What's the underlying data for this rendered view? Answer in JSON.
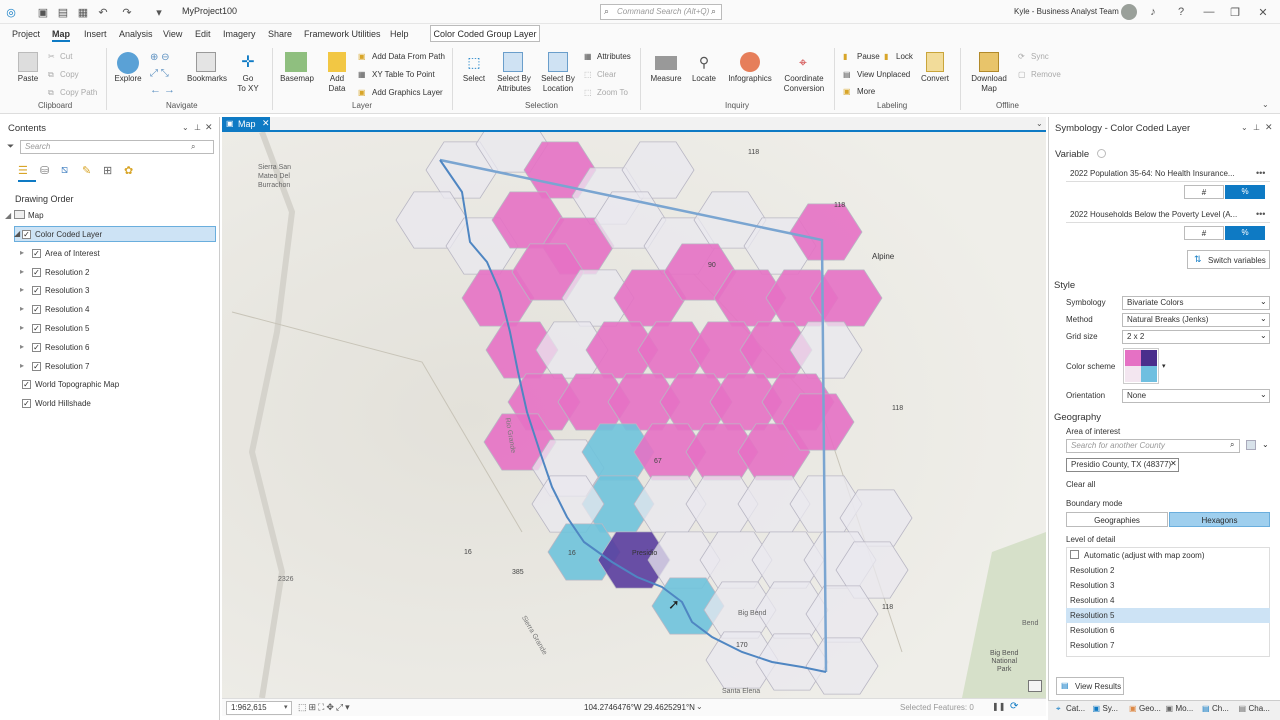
{
  "titlebar": {
    "project": "MyProject100",
    "search_placeholder": "Command Search (Alt+Q)",
    "user": "Kyle - Business Analyst Team"
  },
  "menu": {
    "tabs": [
      "Project",
      "Map",
      "Insert",
      "Analysis",
      "View",
      "Edit",
      "Imagery",
      "Share",
      "Framework Utilities",
      "Help"
    ],
    "contextual_tab": "Color Coded Group Layer"
  },
  "ribbon": {
    "clipboard": {
      "paste": "Paste",
      "cut": "Cut",
      "copy": "Copy",
      "copy_path": "Copy Path",
      "group": "Clipboard"
    },
    "navigate": {
      "explore": "Explore",
      "bookmarks": "Bookmarks",
      "goto_1": "Go",
      "goto_2": "To XY",
      "group": "Navigate"
    },
    "layer": {
      "basemap": "Basemap",
      "add_1": "Add",
      "add_2": "Data",
      "add_data_from_path": "Add Data From Path",
      "xy_table": "XY Table To Point",
      "add_graphics": "Add Graphics Layer",
      "group": "Layer"
    },
    "selection": {
      "select": "Select",
      "by_attr_1": "Select By",
      "by_attr_2": "Attributes",
      "by_loc_1": "Select By",
      "by_loc_2": "Location",
      "attributes": "Attributes",
      "clear": "Clear",
      "zoom_to": "Zoom To",
      "group": "Selection"
    },
    "inquiry": {
      "measure": "Measure",
      "locate": "Locate",
      "infographics": "Infographics",
      "coord_1": "Coordinate",
      "coord_2": "Conversion",
      "group": "Inquiry"
    },
    "labeling": {
      "pause": "Pause",
      "lock": "Lock",
      "view_unplaced": "View Unplaced",
      "more": "More",
      "convert": "Convert",
      "group": "Labeling"
    },
    "offline": {
      "download_1": "Download",
      "download_2": "Map",
      "sync": "Sync",
      "remove": "Remove",
      "group": "Offline"
    }
  },
  "contents": {
    "title": "Contents",
    "search_placeholder": "Search",
    "drawing_order": "Drawing Order",
    "map": "Map",
    "layers": [
      {
        "name": "Color Coded Layer",
        "checked": true,
        "selected": true,
        "level": 1
      },
      {
        "name": "Area of Interest",
        "checked": true,
        "level": 2
      },
      {
        "name": "Resolution 2",
        "checked": true,
        "level": 2
      },
      {
        "name": "Resolution 3",
        "checked": true,
        "level": 2
      },
      {
        "name": "Resolution 4",
        "checked": true,
        "level": 2
      },
      {
        "name": "Resolution 5",
        "checked": true,
        "level": 2
      },
      {
        "name": "Resolution 6",
        "checked": true,
        "level": 2
      },
      {
        "name": "Resolution 7",
        "checked": true,
        "level": 2
      },
      {
        "name": "World Topographic Map",
        "checked": true,
        "level": 1
      },
      {
        "name": "World Hillshade",
        "checked": true,
        "level": 1
      }
    ]
  },
  "map": {
    "tab": "Map",
    "labels": {
      "sierra1": "Sierra San",
      "sierra2": "Mateo Del",
      "sierra3": "Burrachon",
      "alpine": "Alpine",
      "presidio": "Presidio",
      "rio": "Rio Grande",
      "sierra_grande": "Sierra Grande",
      "santa_elena": "Santa Elena",
      "big_bend": "Big Bend",
      "bb_nat1": "Big Bend",
      "bb_nat2": "National",
      "bb_nat3": "Park",
      "bend": "Bend",
      "r118a": "118",
      "r118b": "118",
      "r118c": "118",
      "r118d": "118",
      "r90": "90",
      "r67": "67",
      "r16": "16",
      "r16b": "16",
      "r2326": "2326",
      "r170": "170",
      "r385": "385"
    },
    "colors": {
      "pink": "#e571c4",
      "purple": "#5a3d9e",
      "blue": "#6fc3dc",
      "neutral": "#e9e8ef",
      "outline": "#7aa5d1"
    }
  },
  "statusbar": {
    "scale": "1:962,615",
    "coords": "104.2746476°W 29.4625291°N",
    "selected": "Selected Features: 0"
  },
  "symbology": {
    "title": "Symbology - Color Coded Layer",
    "variable_header": "Variable",
    "var1": "2022 Population 35-64: No Health Insurance...",
    "var2": "2022 Households Below the Poverty Level (A...",
    "hash": "#",
    "pct": "%",
    "switch": "Switch variables",
    "style_header": "Style",
    "symbology_label": "Symbology",
    "symbology_value": "Bivariate Colors",
    "method_label": "Method",
    "method_value": "Natural Breaks (Jenks)",
    "grid_label": "Grid size",
    "grid_value": "2 x 2",
    "scheme_label": "Color scheme",
    "orientation_label": "Orientation",
    "orientation_value": "None",
    "geography_header": "Geography",
    "aoi_label": "Area of interest",
    "aoi_placeholder": "Search for another County",
    "aoi_chip": "Presidio County, TX (48377)",
    "clear_all": "Clear all",
    "boundary_label": "Boundary mode",
    "geographies": "Geographies",
    "hexagons": "Hexagons",
    "lod_label": "Level of detail",
    "automatic": "Automatic (adjust with map zoom)",
    "resolutions": [
      "Resolution 2",
      "Resolution 3",
      "Resolution 4",
      "Resolution 5",
      "Resolution 6",
      "Resolution 7"
    ],
    "selected_resolution": 3,
    "view_results": "View Results",
    "scheme_colors": {
      "tl": "#e571c4",
      "tr": "#4a2e8c",
      "bl": "#f3e6f0",
      "br": "#6fbfe0"
    }
  },
  "taskbar": {
    "items": [
      "Cat...",
      "Sy...",
      "Geo...",
      "Mo...",
      "Ch...",
      "Cha..."
    ]
  }
}
